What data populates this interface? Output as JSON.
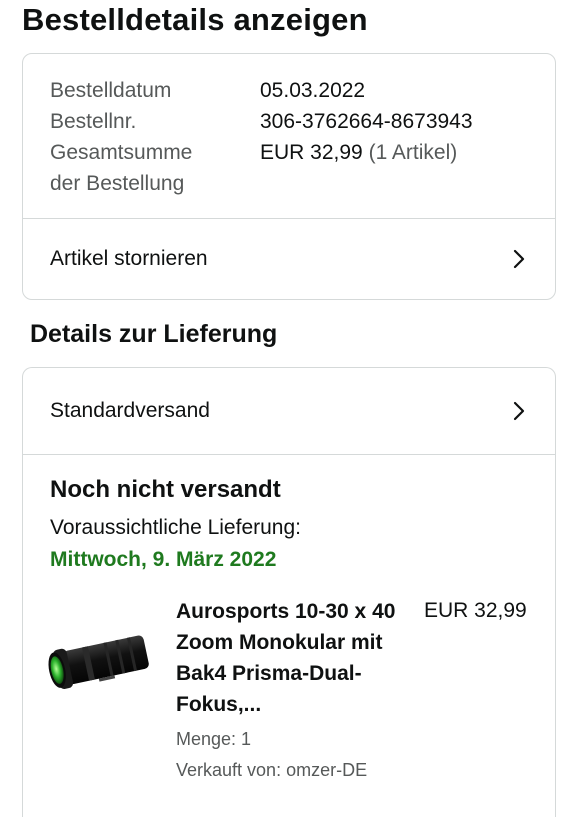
{
  "page": {
    "title": "Bestelldetails anzeigen"
  },
  "order_summary": {
    "date_label": "Bestelldatum",
    "date_value": "05.03.2022",
    "number_label": "Bestellnr.",
    "number_value": "306-3762664-8673943",
    "total_label_line1": "Gesamtsumme",
    "total_label_line2": "der Bestellung",
    "total_value": "EUR 32,99",
    "total_items": "(1 Artikel)",
    "cancel_label": "Artikel stornieren"
  },
  "delivery": {
    "section_title": "Details zur Lieferung",
    "shipping_method": "Standardversand",
    "status": "Noch nicht versandt",
    "eta_label": "Voraussichtliche Lieferung:",
    "eta_date": "Mittwoch, 9. März 2022",
    "eta_color": "#1f7a1f"
  },
  "product": {
    "title": "Aurosports 10-30 x 40 Zoom Monokular mit Bak4 Prisma-Dual-Fokus,...",
    "price": "EUR 32,99",
    "quantity": "Menge: 1",
    "seller": "Verkauft von: omzer-DE",
    "image": "monocular-image"
  },
  "icons": {
    "chevron": "chevron-right-icon"
  }
}
